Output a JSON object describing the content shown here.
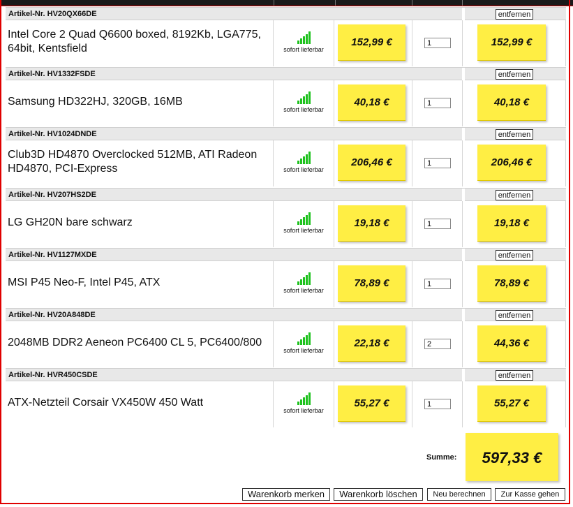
{
  "cart": {
    "items": [
      {
        "article": "Artikel-Nr. HV20QX66DE",
        "name_lines": [
          "Intel Core 2 Quad Q6600 boxed, 8192Kb, LGA775,",
          "64bit, Kentsfield"
        ],
        "availability": "sofort lieferbar",
        "price": "152,99 €",
        "quantity": "1",
        "total": "152,99 €",
        "remove_label": "entfernen"
      },
      {
        "article": "Artikel-Nr. HV1332FSDE",
        "name_lines": [
          "Samsung HD322HJ, 320GB, 16MB"
        ],
        "availability": "sofort lieferbar",
        "price": "40,18 €",
        "quantity": "1",
        "total": "40,18 €",
        "remove_label": "entfernen"
      },
      {
        "article": "Artikel-Nr. HV1024DNDE",
        "name_lines": [
          "Club3D HD4870 Overclocked 512MB, ATI Radeon",
          "HD4870, PCI-Express"
        ],
        "availability": "sofort lieferbar",
        "price": "206,46 €",
        "quantity": "1",
        "total": "206,46 €",
        "remove_label": "entfernen"
      },
      {
        "article": "Artikel-Nr. HV207HS2DE",
        "name_lines": [
          "LG GH20N bare schwarz"
        ],
        "availability": "sofort lieferbar",
        "price": "19,18 €",
        "quantity": "1",
        "total": "19,18 €",
        "remove_label": "entfernen"
      },
      {
        "article": "Artikel-Nr. HV1127MXDE",
        "name_lines": [
          "MSI P45 Neo-F, Intel P45, ATX"
        ],
        "availability": "sofort lieferbar",
        "price": "78,89 €",
        "quantity": "1",
        "total": "78,89 €",
        "remove_label": "entfernen"
      },
      {
        "article": "Artikel-Nr. HV20A848DE",
        "name_lines": [
          "2048MB DDR2 Aeneon PC6400 CL 5, PC6400/800"
        ],
        "availability": "sofort lieferbar",
        "price": "22,18 €",
        "quantity": "2",
        "total": "44,36 €",
        "remove_label": "entfernen"
      },
      {
        "article": "Artikel-Nr. HVR450CSDE",
        "name_lines": [
          "ATX-Netzteil Corsair VX450W 450 Watt"
        ],
        "availability": "sofort lieferbar",
        "price": "55,27 €",
        "quantity": "1",
        "total": "55,27 €",
        "remove_label": "entfernen"
      }
    ],
    "summary_label": "Summe:",
    "summary_total": "597,33 €"
  },
  "buttons": {
    "save_cart": "Warenkorb merken",
    "clear_cart": "Warenkorb löschen",
    "recalculate": "Neu berechnen",
    "checkout": "Zur Kasse gehen"
  },
  "colors": {
    "frame": "#e00000",
    "note": "#ffee44",
    "availability_bars": "#1ec21e"
  },
  "icons": {
    "availability": "signal-bars-icon"
  }
}
